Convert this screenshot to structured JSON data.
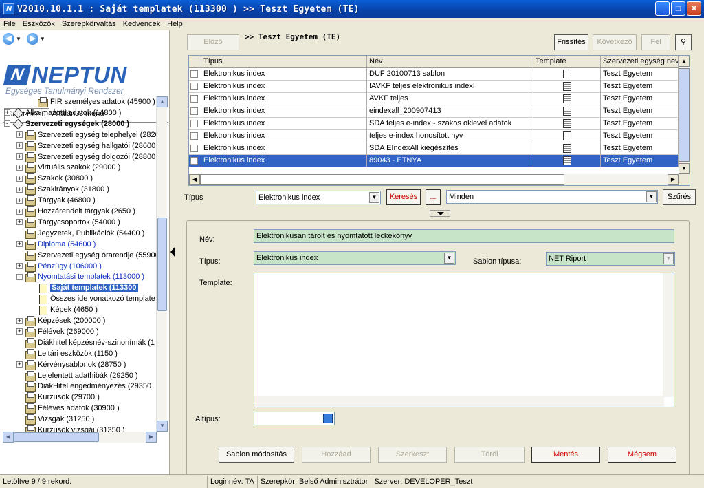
{
  "window": {
    "title": "V2010.10.1.1 : Saját templatek (113300  )  >> Teszt Egyetem  (TE)",
    "app_icon": "N"
  },
  "menu": [
    "File",
    "Eszközök",
    "Szerepkörváltás",
    "Kedvencek",
    "Help"
  ],
  "logo": {
    "mark": "N",
    "text": "NEPTUN",
    "subtitle": "Egységes Tanulmányi Rendszer"
  },
  "left_tabs": [
    "Saját menü",
    "Általános menü"
  ],
  "tree": [
    {
      "label": "FIR személyes adatok (45900 )",
      "indent": 2,
      "icon": "folder",
      "tog": ""
    },
    {
      "label": "Alkalmazotti adatok (14800  )",
      "indent": 0,
      "icon": "dia",
      "tog": "+"
    },
    {
      "label": "Szervezeti egységek (28000  )",
      "indent": 0,
      "icon": "dia",
      "tog": "-",
      "bold": true
    },
    {
      "label": "Szervezeti egység telephelyei (2820",
      "indent": 1,
      "icon": "folder",
      "tog": "+"
    },
    {
      "label": "Szervezeti egység hallgatói (28600",
      "indent": 1,
      "icon": "folder",
      "tog": "+"
    },
    {
      "label": "Szervezeti egység dolgozói (28800",
      "indent": 1,
      "icon": "folder",
      "tog": "+"
    },
    {
      "label": "Virtuális szakok (29000  )",
      "indent": 1,
      "icon": "folder",
      "tog": "+"
    },
    {
      "label": "Szakok (30800  )",
      "indent": 1,
      "icon": "folder",
      "tog": "+"
    },
    {
      "label": "Szakirányok (31800  )",
      "indent": 1,
      "icon": "folder",
      "tog": "+"
    },
    {
      "label": "Tárgyak (46800  )",
      "indent": 1,
      "icon": "folder",
      "tog": "+"
    },
    {
      "label": "Hozzárendelt tárgyak (2650  )",
      "indent": 1,
      "icon": "folder",
      "tog": "+"
    },
    {
      "label": "Tárgycsoportok (54000  )",
      "indent": 1,
      "icon": "folder",
      "tog": "+"
    },
    {
      "label": "Jegyzetek, Publikációk (54400  )",
      "indent": 1,
      "icon": "folder",
      "tog": ""
    },
    {
      "label": "Diploma (54600  )",
      "indent": 1,
      "icon": "folder",
      "tog": "+",
      "blue": true
    },
    {
      "label": "Szervezeti egység órarendje (55900",
      "indent": 1,
      "icon": "folder",
      "tog": ""
    },
    {
      "label": "Pénzügy (106000  )",
      "indent": 1,
      "icon": "folder",
      "tog": "+",
      "blue": true
    },
    {
      "label": "Nyomtatási templatek (113000  )",
      "indent": 1,
      "icon": "folder",
      "tog": "-",
      "blue": true
    },
    {
      "label": "Saját templatek (113300",
      "indent": 2,
      "icon": "doc",
      "tog": "",
      "selected": true
    },
    {
      "label": "Összes ide vonatkozó template",
      "indent": 2,
      "icon": "doc",
      "tog": ""
    },
    {
      "label": "Képek (4650  )",
      "indent": 2,
      "icon": "doc",
      "tog": ""
    },
    {
      "label": "Képzések (200000  )",
      "indent": 1,
      "icon": "folder",
      "tog": "+"
    },
    {
      "label": "Félévek (269000  )",
      "indent": 1,
      "icon": "folder",
      "tog": "+"
    },
    {
      "label": "Diákhitel képzésnév-szinonímák (1",
      "indent": 1,
      "icon": "folder",
      "tog": ""
    },
    {
      "label": "Leltári eszközök (1150  )",
      "indent": 1,
      "icon": "folder",
      "tog": ""
    },
    {
      "label": "Kérvénysablonok (28750  )",
      "indent": 1,
      "icon": "folder",
      "tog": "+"
    },
    {
      "label": "Lejelentett adathibák (29250  )",
      "indent": 1,
      "icon": "folder",
      "tog": ""
    },
    {
      "label": "DiákHitel engedményezés (29350",
      "indent": 1,
      "icon": "folder",
      "tog": ""
    },
    {
      "label": "Kurzusok (29700  )",
      "indent": 1,
      "icon": "folder",
      "tog": ""
    },
    {
      "label": "Féléves adatok (30900  )",
      "indent": 1,
      "icon": "folder",
      "tog": ""
    },
    {
      "label": "Vizsgák (31250  )",
      "indent": 1,
      "icon": "folder",
      "tog": ""
    },
    {
      "label": "Kurzusok vizsgái (31350  )",
      "indent": 1,
      "icon": "folder",
      "tog": ""
    }
  ],
  "toolbar": {
    "prev": "Előző",
    "breadcrumb": ">> Teszt Egyetem  (TE)",
    "refresh": "Frissítés",
    "next": "Következő",
    "up": "Fel"
  },
  "grid": {
    "headers": [
      "",
      "Típus",
      "Név",
      "Template",
      "Szervezeti egység nev"
    ],
    "rows": [
      {
        "tipus": "Elektronikus index",
        "nev": "DUF 20100713 sablon",
        "szerv": "Teszt Egyetem"
      },
      {
        "tipus": "Elektronikus index",
        "nev": "!AVKF teljes elektronikus index!",
        "szerv": "Teszt Egyetem"
      },
      {
        "tipus": "Elektronikus index",
        "nev": "AVKF teljes",
        "szerv": "Teszt Egyetem"
      },
      {
        "tipus": "Elektronikus index",
        "nev": "eindexall_200907413",
        "szerv": "Teszt Egyetem"
      },
      {
        "tipus": "Elektronikus index",
        "nev": "SDA teljes e-index - szakos oklevél adatok",
        "szerv": "Teszt Egyetem"
      },
      {
        "tipus": "Elektronikus index",
        "nev": "teljes e-index honosított  nyv",
        "szerv": "Teszt Egyetem"
      },
      {
        "tipus": "Elektronikus index",
        "nev": "SDA EIndexAll kiegészítés",
        "szerv": "Teszt Egyetem"
      },
      {
        "tipus": "Elektronikus index",
        "nev": "89043 - ETNYA",
        "szerv": "Teszt Egyetem",
        "selected": true
      }
    ]
  },
  "filter": {
    "label": "Típus",
    "type_value": "Elektronikus index",
    "search": "Keresés",
    "ellipsis": "...",
    "scope_value": "Minden",
    "filter_button": "Szűrés"
  },
  "detail": {
    "name_label": "Név:",
    "name_value": "Elektronikusan tárolt és nyomtatott leckekönyv",
    "type_label": "Típus:",
    "type_value": "Elektronikus index",
    "template_type_label": "Sablon típusa:",
    "template_type_value": "NET Riport",
    "template_label": "Template:",
    "subtype_label": "Altípus:",
    "subtype_value": ""
  },
  "actions": {
    "modify": "Sablon módosítás",
    "add": "Hozzáad",
    "edit": "Szerkeszt",
    "delete": "Töröl",
    "save": "Mentés",
    "cancel": "Mégsem"
  },
  "status": {
    "records": "Letöltve 9 / 9 rekord.",
    "login": "Loginnév: TA",
    "role": "Szerepkör: Belső Adminisztrátor",
    "server": "Szerver: DEVELOPER_Teszt"
  }
}
